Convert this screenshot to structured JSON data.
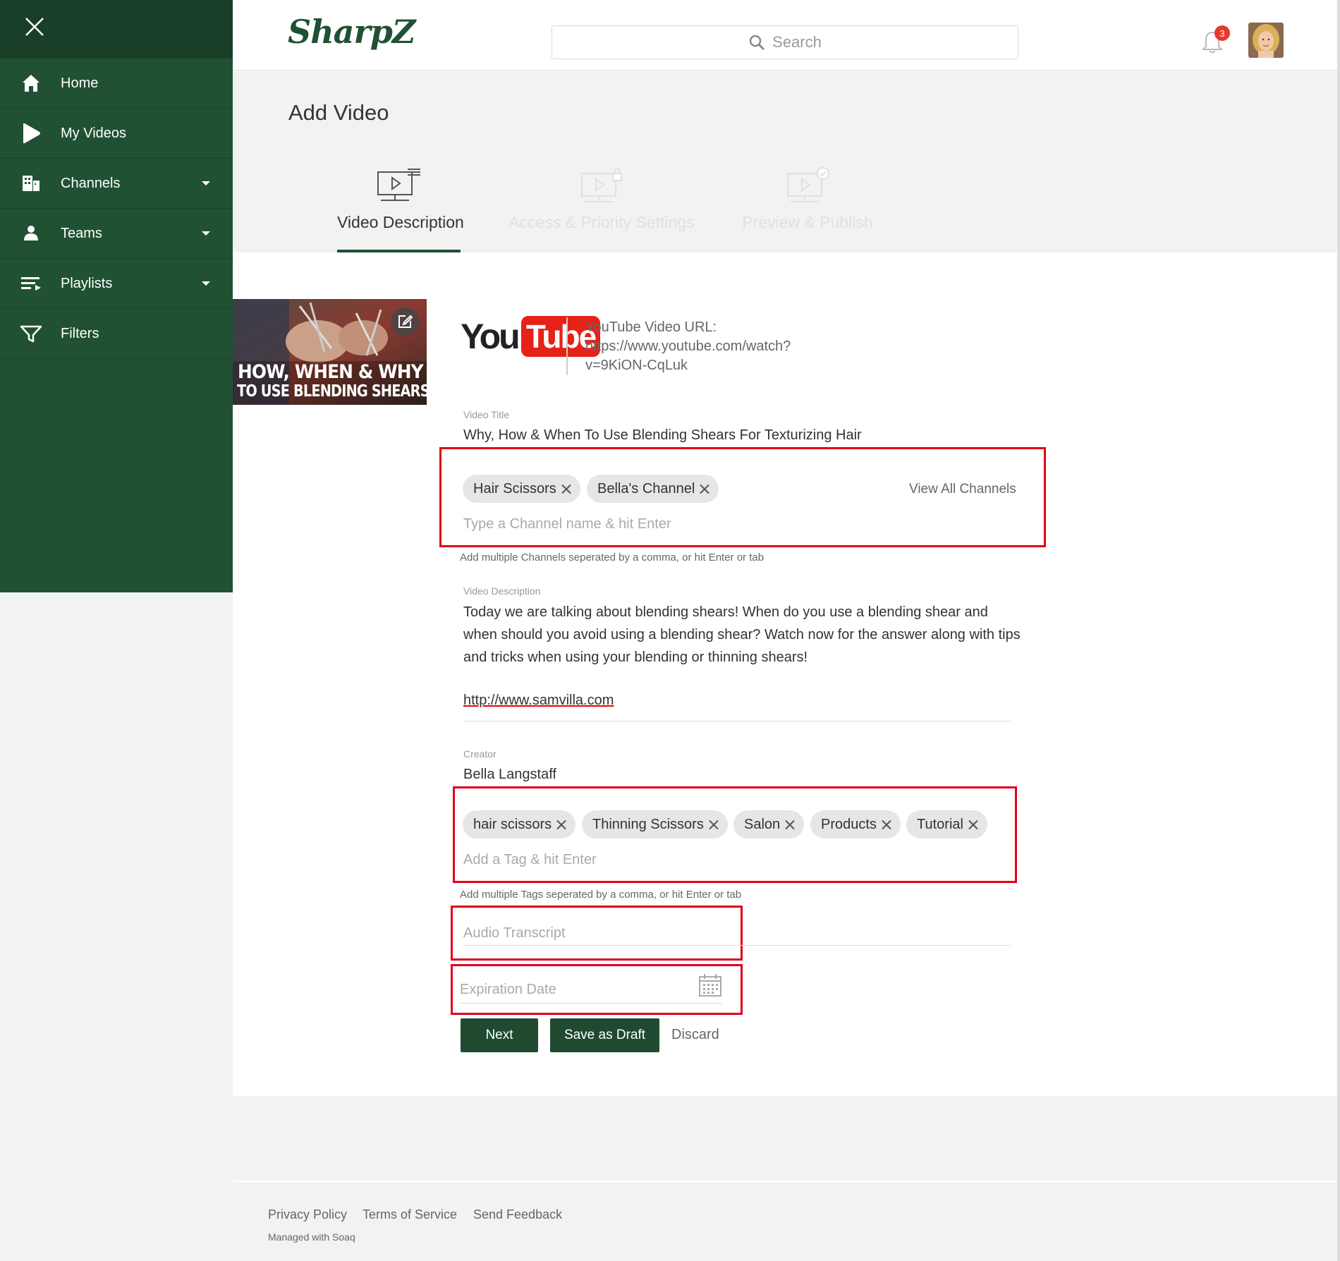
{
  "sidebar": {
    "items": [
      {
        "label": "Home",
        "icon": "home-icon"
      },
      {
        "label": "My Videos",
        "icon": "play-icon"
      },
      {
        "label": "Channels",
        "icon": "channels-icon"
      },
      {
        "label": "Teams",
        "icon": "team-icon"
      },
      {
        "label": "Playlists",
        "icon": "playlist-icon"
      },
      {
        "label": "Filters",
        "icon": "filter-icon"
      }
    ]
  },
  "header": {
    "logo_text": "SharpZ",
    "search_placeholder": "Search",
    "notification_count": "3"
  },
  "page": {
    "title": "Add Video"
  },
  "steps": [
    {
      "label": "Video Description",
      "state": "active"
    },
    {
      "label": "Access & Priority Settings",
      "state": "disabled"
    },
    {
      "label": "Preview & Publish",
      "state": "disabled"
    }
  ],
  "thumbnail": {
    "line1": "HOW, WHEN & WHY",
    "line2": "TO USE BLENDING SHEARS"
  },
  "youtube": {
    "logo_you": "You",
    "logo_tube": "Tube",
    "url_label": "YouTube Video URL:",
    "url_line1": "https://www.youtube.com/watch?",
    "url_line2": "v=9KiON-CqLuk"
  },
  "form": {
    "title_label": "Video Title",
    "title_value": "Why, How & When To Use Blending Shears For Texturizing Hair",
    "channels": [
      "Hair Scissors",
      "Bella's Channel"
    ],
    "view_all_channels": "View All Channels",
    "channel_placeholder": "Type a Channel name & hit Enter",
    "channel_helper": "Add multiple Channels seperated by a comma, or hit Enter or tab",
    "description_label": "Video Description",
    "description_value": "Today we are talking about blending shears! When do you use a blending shear and when should you avoid using a blending shear? Watch now for the answer along with tips and tricks when using your blending or thinning shears!",
    "description_link": "http://www.samvilla.com",
    "creator_label": "Creator",
    "creator_value": "Bella Langstaff",
    "tags": [
      "hair scissors",
      "Thinning Scissors",
      "Salon",
      "Products",
      "Tutorial"
    ],
    "tag_placeholder": "Add a Tag & hit Enter",
    "tag_helper": "Add multiple Tags seperated by a comma, or hit Enter or tab",
    "transcript_placeholder": "Audio Transcript",
    "expiration_placeholder": "Expiration Date"
  },
  "buttons": {
    "next": "Next",
    "save_draft": "Save as Draft",
    "discard": "Discard"
  },
  "footer": {
    "privacy": "Privacy Policy",
    "terms": "Terms of Service",
    "feedback": "Send Feedback",
    "managed": "Managed with Soaq"
  },
  "colors": {
    "brand_green": "#215133",
    "highlight_red": "#e00018",
    "badge_red": "#e8382b"
  }
}
